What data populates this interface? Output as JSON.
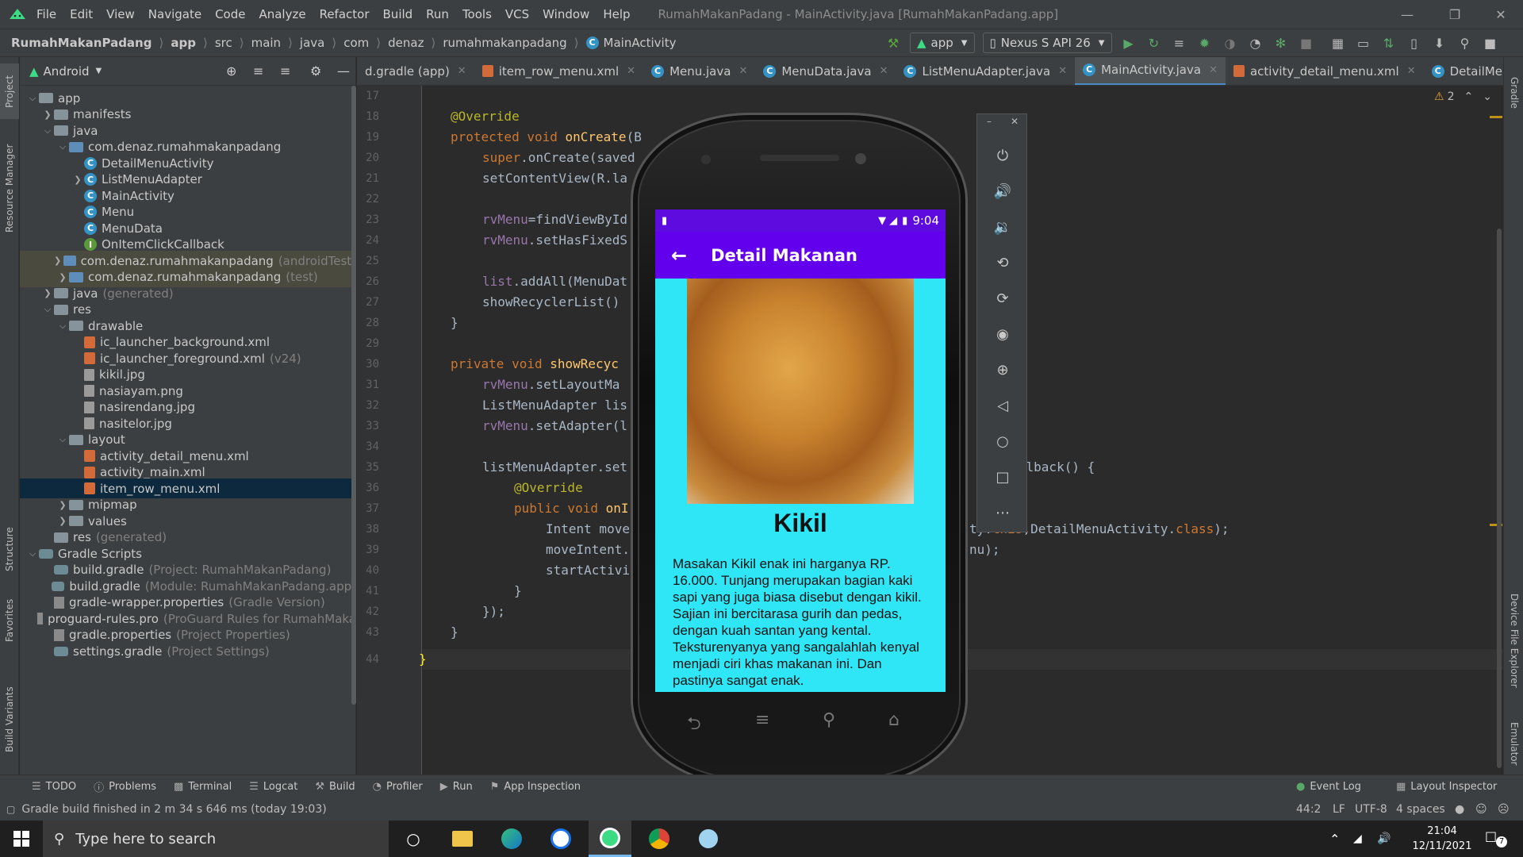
{
  "menubar": {
    "items": [
      "File",
      "Edit",
      "View",
      "Navigate",
      "Code",
      "Analyze",
      "Refactor",
      "Build",
      "Run",
      "Tools",
      "VCS",
      "Window",
      "Help"
    ],
    "window_title": "RumahMakanPadang - MainActivity.java [RumahMakanPadang.app]"
  },
  "breadcrumb": [
    "RumahMakanPadang",
    "app",
    "src",
    "main",
    "java",
    "com",
    "denaz",
    "rumahmakanpadang",
    "MainActivity"
  ],
  "toolbar": {
    "run_config": "app",
    "device": "Nexus S API 26"
  },
  "project": {
    "view_mode": "Android",
    "tree": [
      {
        "label": "app",
        "extra": "",
        "icon": "folder-icon"
      },
      {
        "label": "manifests",
        "extra": "",
        "icon": "folder-icon"
      },
      {
        "label": "java",
        "extra": "",
        "icon": "folder-icon"
      },
      {
        "label": "com.denaz.rumahmakanpadang",
        "extra": "",
        "icon": "package-icon"
      },
      {
        "label": "DetailMenuActivity",
        "extra": "",
        "icon": "class-icon"
      },
      {
        "label": "ListMenuAdapter",
        "extra": "",
        "icon": "class-icon"
      },
      {
        "label": "MainActivity",
        "extra": "",
        "icon": "class-icon"
      },
      {
        "label": "Menu",
        "extra": "",
        "icon": "class-icon"
      },
      {
        "label": "MenuData",
        "extra": "",
        "icon": "class-icon"
      },
      {
        "label": "OnItemClickCallback",
        "extra": "",
        "icon": "interface-icon"
      },
      {
        "label": "com.denaz.rumahmakanpadang",
        "extra": "(androidTest)",
        "icon": "package-icon"
      },
      {
        "label": "com.denaz.rumahmakanpadang",
        "extra": "(test)",
        "icon": "package-icon"
      },
      {
        "label": "java",
        "extra": "(generated)",
        "icon": "folder-icon"
      },
      {
        "label": "res",
        "extra": "",
        "icon": "folder-icon"
      },
      {
        "label": "drawable",
        "extra": "",
        "icon": "folder-icon"
      },
      {
        "label": "ic_launcher_background.xml",
        "extra": "",
        "icon": "xml-icon"
      },
      {
        "label": "ic_launcher_foreground.xml",
        "extra": "(v24)",
        "icon": "xml-icon"
      },
      {
        "label": "kikil.jpg",
        "extra": "",
        "icon": "image-icon"
      },
      {
        "label": "nasiayam.png",
        "extra": "",
        "icon": "image-icon"
      },
      {
        "label": "nasirendang.jpg",
        "extra": "",
        "icon": "image-icon"
      },
      {
        "label": "nasitelor.jpg",
        "extra": "",
        "icon": "image-icon"
      },
      {
        "label": "layout",
        "extra": "",
        "icon": "folder-icon"
      },
      {
        "label": "activity_detail_menu.xml",
        "extra": "",
        "icon": "xml-icon"
      },
      {
        "label": "activity_main.xml",
        "extra": "",
        "icon": "xml-icon"
      },
      {
        "label": "item_row_menu.xml",
        "extra": "",
        "icon": "xml-icon"
      },
      {
        "label": "mipmap",
        "extra": "",
        "icon": "folder-icon"
      },
      {
        "label": "values",
        "extra": "",
        "icon": "folder-icon"
      },
      {
        "label": "res",
        "extra": "(generated)",
        "icon": "folder-icon"
      },
      {
        "label": "Gradle Scripts",
        "extra": "",
        "icon": "gradle-icon"
      },
      {
        "label": "build.gradle",
        "extra": "(Project: RumahMakanPadang)",
        "icon": "gradle-icon"
      },
      {
        "label": "build.gradle",
        "extra": "(Module: RumahMakanPadang.app)",
        "icon": "gradle-icon"
      },
      {
        "label": "gradle-wrapper.properties",
        "extra": "(Gradle Version)",
        "icon": "properties-icon"
      },
      {
        "label": "proguard-rules.pro",
        "extra": "(ProGuard Rules for RumahMaka",
        "icon": "properties-icon"
      },
      {
        "label": "gradle.properties",
        "extra": "(Project Properties)",
        "icon": "properties-icon"
      },
      {
        "label": "settings.gradle",
        "extra": "(Project Settings)",
        "icon": "gradle-icon"
      }
    ]
  },
  "tabs": [
    {
      "label": "d.gradle (app)"
    },
    {
      "label": "item_row_menu.xml"
    },
    {
      "label": "Menu.java"
    },
    {
      "label": "MenuData.java"
    },
    {
      "label": "ListMenuAdapter.java"
    },
    {
      "label": "MainActivity.java"
    },
    {
      "label": "activity_detail_menu.xml"
    },
    {
      "label": "DetailMenuActivity.java"
    }
  ],
  "editor": {
    "warnings": "2",
    "line_numbers": [
      "17",
      "18",
      "19",
      "20",
      "21",
      "22",
      "23",
      "24",
      "25",
      "26",
      "27",
      "28",
      "29",
      "30",
      "31",
      "32",
      "33",
      "34",
      "35",
      "36",
      "37",
      "38",
      "39",
      "40",
      "41",
      "42",
      "43",
      "44"
    ],
    "code": {
      "l18": "@Override",
      "l19_kw": "protected void ",
      "l19_fn": "onCreate",
      "l19_rest": "(B",
      "l20_kw": "super",
      "l20_rest": ".onCreate(saved",
      "l21": "setContentView(R.la",
      "l23_fld": "rvMenu",
      "l23_rest": "=findViewById",
      "l24_fld": "rvMenu",
      "l24_rest": ".setHasFixedS",
      "l26_fld": "list",
      "l26_rest": ".addAll(MenuDat",
      "l27": "showRecyclerList()",
      "l28": "}",
      "l30_kw": "private void ",
      "l30_fn": "showRecyc",
      "l31_fld": "rvMenu",
      "l31_rest": ".setLayoutMa",
      "l32": "ListMenuAdapter lis",
      "l33_fld": "rvMenu",
      "l33_rest": ".setAdapter(l",
      "l35": "listMenuAdapter.set",
      "l35_right": "kCallback() {",
      "l36": "@Override",
      "l37_kw": "public void ",
      "l37_fn": "onI",
      "l38": "Intent move",
      "l38_right_a": "ty.",
      "l38_right_kw": "this",
      "l38_right_b": ",DetailMenuActivity.",
      "l38_right_kw2": "class",
      "l38_right_c": ");",
      "l39": "moveIntent.",
      "l39_right": "nu);",
      "l40": "startActivi",
      "l41": "}",
      "l42": "});",
      "l43": "}",
      "l44": "}"
    }
  },
  "emulator": {
    "status_time": "9:04",
    "app_title": "Detail Makanan",
    "food_name": "Kikil",
    "food_description": "Masakan Kikil enak ini harganya RP. 16.000. Tunjang merupakan bagian kaki sapi yang juga biasa disebut dengan kikil. Sajian ini bercitarasa gurih dan pedas, dengan kuah santan yang kental. Teksturenyanya yang sangalahlah kenyal menjadi ciri khas makanan ini. Dan pastinya sangat enak."
  },
  "toolwindows": [
    "TODO",
    "Problems",
    "Terminal",
    "Logcat",
    "Build",
    "Profiler",
    "Run",
    "App Inspection"
  ],
  "toolwindows_right": [
    "Event Log",
    "Layout Inspector"
  ],
  "side_tabs_left": [
    "Project",
    "Resource Manager",
    "Structure",
    "Favorites",
    "Build Variants"
  ],
  "side_tabs_right": [
    "Gradle",
    "Device File Explorer",
    "Emulator"
  ],
  "status": {
    "message": "Gradle build finished in 2 m 34 s 646 ms (today 19:03)",
    "position": "44:2",
    "line_sep": "LF",
    "encoding": "UTF-8",
    "indent": "4 spaces"
  },
  "taskbar": {
    "search_placeholder": "Type here to search",
    "time": "21:04",
    "date": "12/11/2021",
    "notifications": "7"
  }
}
